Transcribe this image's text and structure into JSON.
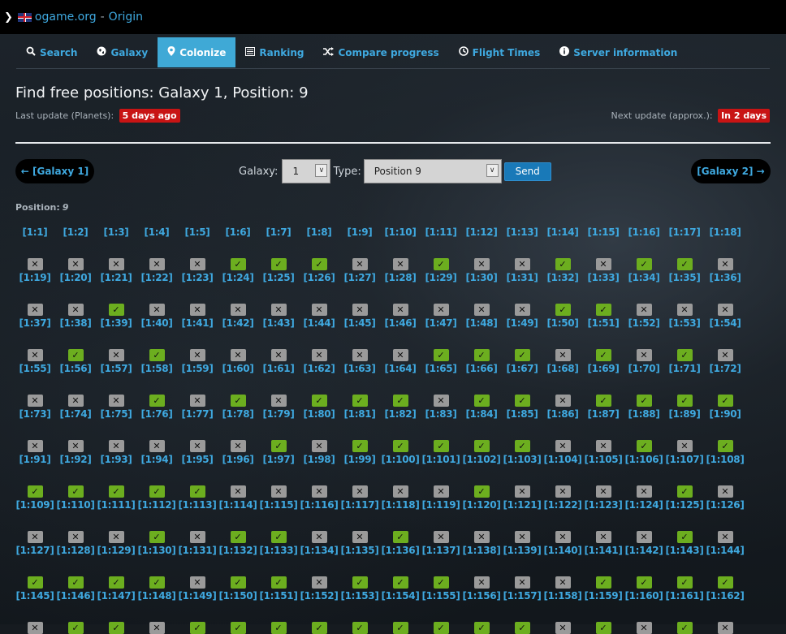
{
  "topbar": {
    "site": "ogame.org",
    "separator": "-",
    "universe": "Origin"
  },
  "nav": [
    {
      "label": "Search",
      "icon": "search-icon",
      "active": false
    },
    {
      "label": "Galaxy",
      "icon": "globe-icon",
      "active": false
    },
    {
      "label": "Colonize",
      "icon": "map-pin-icon",
      "active": true
    },
    {
      "label": "Ranking",
      "icon": "list-icon",
      "active": false
    },
    {
      "label": "Compare progress",
      "icon": "shuffle-icon",
      "active": false
    },
    {
      "label": "Flight Times",
      "icon": "clock-icon",
      "active": false
    },
    {
      "label": "Server information",
      "icon": "info-icon",
      "active": false
    }
  ],
  "page": {
    "title": "Find free positions: Galaxy 1, Position: 9",
    "last_update_label": "Last update (Planets):",
    "last_update_value": "5 days ago",
    "next_update_label": "Next update (approx.):",
    "next_update_value": "In 2 days"
  },
  "pager": {
    "prev": "← [Galaxy 1]",
    "next": "[Galaxy 2] →"
  },
  "form": {
    "galaxy_label": "Galaxy:",
    "galaxy_value": "1",
    "type_label": "Type:",
    "type_value": "Position 9",
    "send_label": "Send"
  },
  "position": {
    "label": "Position:",
    "value": "9"
  },
  "status_legend": {
    "free": "✓",
    "taken": "✕"
  },
  "systems": [
    {
      "coord": "[1:1]",
      "free": false
    },
    {
      "coord": "[1:2]",
      "free": false
    },
    {
      "coord": "[1:3]",
      "free": false
    },
    {
      "coord": "[1:4]",
      "free": false
    },
    {
      "coord": "[1:5]",
      "free": false
    },
    {
      "coord": "[1:6]",
      "free": true
    },
    {
      "coord": "[1:7]",
      "free": true
    },
    {
      "coord": "[1:8]",
      "free": true
    },
    {
      "coord": "[1:9]",
      "free": false
    },
    {
      "coord": "[1:10]",
      "free": false
    },
    {
      "coord": "[1:11]",
      "free": true
    },
    {
      "coord": "[1:12]",
      "free": false
    },
    {
      "coord": "[1:13]",
      "free": false
    },
    {
      "coord": "[1:14]",
      "free": true
    },
    {
      "coord": "[1:15]",
      "free": false
    },
    {
      "coord": "[1:16]",
      "free": true
    },
    {
      "coord": "[1:17]",
      "free": true
    },
    {
      "coord": "[1:18]",
      "free": false
    },
    {
      "coord": "[1:19]",
      "free": false
    },
    {
      "coord": "[1:20]",
      "free": false
    },
    {
      "coord": "[1:21]",
      "free": true
    },
    {
      "coord": "[1:22]",
      "free": false
    },
    {
      "coord": "[1:23]",
      "free": false
    },
    {
      "coord": "[1:24]",
      "free": false
    },
    {
      "coord": "[1:25]",
      "free": false
    },
    {
      "coord": "[1:26]",
      "free": false
    },
    {
      "coord": "[1:27]",
      "free": false
    },
    {
      "coord": "[1:28]",
      "free": false
    },
    {
      "coord": "[1:29]",
      "free": false
    },
    {
      "coord": "[1:30]",
      "free": false
    },
    {
      "coord": "[1:31]",
      "free": false
    },
    {
      "coord": "[1:32]",
      "free": true
    },
    {
      "coord": "[1:33]",
      "free": true
    },
    {
      "coord": "[1:34]",
      "free": false
    },
    {
      "coord": "[1:35]",
      "free": false
    },
    {
      "coord": "[1:36]",
      "free": false
    },
    {
      "coord": "[1:37]",
      "free": false
    },
    {
      "coord": "[1:38]",
      "free": true
    },
    {
      "coord": "[1:39]",
      "free": false
    },
    {
      "coord": "[1:40]",
      "free": true
    },
    {
      "coord": "[1:41]",
      "free": false
    },
    {
      "coord": "[1:42]",
      "free": false
    },
    {
      "coord": "[1:43]",
      "free": false
    },
    {
      "coord": "[1:44]",
      "free": false
    },
    {
      "coord": "[1:45]",
      "free": false
    },
    {
      "coord": "[1:46]",
      "free": false
    },
    {
      "coord": "[1:47]",
      "free": true
    },
    {
      "coord": "[1:48]",
      "free": true
    },
    {
      "coord": "[1:49]",
      "free": true
    },
    {
      "coord": "[1:50]",
      "free": false
    },
    {
      "coord": "[1:51]",
      "free": true
    },
    {
      "coord": "[1:52]",
      "free": false
    },
    {
      "coord": "[1:53]",
      "free": true
    },
    {
      "coord": "[1:54]",
      "free": false
    },
    {
      "coord": "[1:55]",
      "free": false
    },
    {
      "coord": "[1:56]",
      "free": false
    },
    {
      "coord": "[1:57]",
      "free": false
    },
    {
      "coord": "[1:58]",
      "free": true
    },
    {
      "coord": "[1:59]",
      "free": false
    },
    {
      "coord": "[1:60]",
      "free": true
    },
    {
      "coord": "[1:61]",
      "free": false
    },
    {
      "coord": "[1:62]",
      "free": true
    },
    {
      "coord": "[1:63]",
      "free": true
    },
    {
      "coord": "[1:64]",
      "free": true
    },
    {
      "coord": "[1:65]",
      "free": false
    },
    {
      "coord": "[1:66]",
      "free": true
    },
    {
      "coord": "[1:67]",
      "free": true
    },
    {
      "coord": "[1:68]",
      "free": false
    },
    {
      "coord": "[1:69]",
      "free": true
    },
    {
      "coord": "[1:70]",
      "free": true
    },
    {
      "coord": "[1:71]",
      "free": true
    },
    {
      "coord": "[1:72]",
      "free": true
    },
    {
      "coord": "[1:73]",
      "free": false
    },
    {
      "coord": "[1:74]",
      "free": false
    },
    {
      "coord": "[1:75]",
      "free": false
    },
    {
      "coord": "[1:76]",
      "free": false
    },
    {
      "coord": "[1:77]",
      "free": false
    },
    {
      "coord": "[1:78]",
      "free": false
    },
    {
      "coord": "[1:79]",
      "free": true
    },
    {
      "coord": "[1:80]",
      "free": false
    },
    {
      "coord": "[1:81]",
      "free": true
    },
    {
      "coord": "[1:82]",
      "free": true
    },
    {
      "coord": "[1:83]",
      "free": true
    },
    {
      "coord": "[1:84]",
      "free": true
    },
    {
      "coord": "[1:85]",
      "free": true
    },
    {
      "coord": "[1:86]",
      "free": false
    },
    {
      "coord": "[1:87]",
      "free": false
    },
    {
      "coord": "[1:88]",
      "free": true
    },
    {
      "coord": "[1:89]",
      "free": false
    },
    {
      "coord": "[1:90]",
      "free": true
    },
    {
      "coord": "[1:91]",
      "free": true
    },
    {
      "coord": "[1:92]",
      "free": true
    },
    {
      "coord": "[1:93]",
      "free": true
    },
    {
      "coord": "[1:94]",
      "free": true
    },
    {
      "coord": "[1:95]",
      "free": true
    },
    {
      "coord": "[1:96]",
      "free": false
    },
    {
      "coord": "[1:97]",
      "free": false
    },
    {
      "coord": "[1:98]",
      "free": false
    },
    {
      "coord": "[1:99]",
      "free": false
    },
    {
      "coord": "[1:100]",
      "free": false
    },
    {
      "coord": "[1:101]",
      "free": false
    },
    {
      "coord": "[1:102]",
      "free": true
    },
    {
      "coord": "[1:103]",
      "free": false
    },
    {
      "coord": "[1:104]",
      "free": false
    },
    {
      "coord": "[1:105]",
      "free": false
    },
    {
      "coord": "[1:106]",
      "free": false
    },
    {
      "coord": "[1:107]",
      "free": true
    },
    {
      "coord": "[1:108]",
      "free": false
    },
    {
      "coord": "[1:109]",
      "free": false
    },
    {
      "coord": "[1:110]",
      "free": false
    },
    {
      "coord": "[1:111]",
      "free": false
    },
    {
      "coord": "[1:112]",
      "free": true
    },
    {
      "coord": "[1:113]",
      "free": false
    },
    {
      "coord": "[1:114]",
      "free": true
    },
    {
      "coord": "[1:115]",
      "free": true
    },
    {
      "coord": "[1:116]",
      "free": false
    },
    {
      "coord": "[1:117]",
      "free": false
    },
    {
      "coord": "[1:118]",
      "free": true
    },
    {
      "coord": "[1:119]",
      "free": false
    },
    {
      "coord": "[1:120]",
      "free": false
    },
    {
      "coord": "[1:121]",
      "free": false
    },
    {
      "coord": "[1:122]",
      "free": false
    },
    {
      "coord": "[1:123]",
      "free": false
    },
    {
      "coord": "[1:124]",
      "free": false
    },
    {
      "coord": "[1:125]",
      "free": true
    },
    {
      "coord": "[1:126]",
      "free": false
    },
    {
      "coord": "[1:127]",
      "free": true
    },
    {
      "coord": "[1:128]",
      "free": true
    },
    {
      "coord": "[1:129]",
      "free": true
    },
    {
      "coord": "[1:130]",
      "free": true
    },
    {
      "coord": "[1:131]",
      "free": false
    },
    {
      "coord": "[1:132]",
      "free": true
    },
    {
      "coord": "[1:133]",
      "free": true
    },
    {
      "coord": "[1:134]",
      "free": false
    },
    {
      "coord": "[1:135]",
      "free": true
    },
    {
      "coord": "[1:136]",
      "free": true
    },
    {
      "coord": "[1:137]",
      "free": true
    },
    {
      "coord": "[1:138]",
      "free": false
    },
    {
      "coord": "[1:139]",
      "free": false
    },
    {
      "coord": "[1:140]",
      "free": false
    },
    {
      "coord": "[1:141]",
      "free": true
    },
    {
      "coord": "[1:142]",
      "free": true
    },
    {
      "coord": "[1:143]",
      "free": true
    },
    {
      "coord": "[1:144]",
      "free": true
    },
    {
      "coord": "[1:145]",
      "free": false
    },
    {
      "coord": "[1:146]",
      "free": true
    },
    {
      "coord": "[1:147]",
      "free": true
    },
    {
      "coord": "[1:148]",
      "free": false
    },
    {
      "coord": "[1:149]",
      "free": true
    },
    {
      "coord": "[1:150]",
      "free": true
    },
    {
      "coord": "[1:151]",
      "free": true
    },
    {
      "coord": "[1:152]",
      "free": true
    },
    {
      "coord": "[1:153]",
      "free": true
    },
    {
      "coord": "[1:154]",
      "free": true
    },
    {
      "coord": "[1:155]",
      "free": true
    },
    {
      "coord": "[1:156]",
      "free": true
    },
    {
      "coord": "[1:157]",
      "free": true
    },
    {
      "coord": "[1:158]",
      "free": false
    },
    {
      "coord": "[1:159]",
      "free": true
    },
    {
      "coord": "[1:160]",
      "free": false
    },
    {
      "coord": "[1:161]",
      "free": true
    },
    {
      "coord": "[1:162]",
      "free": false
    }
  ],
  "colors": {
    "accent": "#3fa9e0",
    "active_tab": "#3fa9d6",
    "free": "#6cae1f",
    "taken": "#9a9a9a",
    "badge": "#c81414"
  }
}
